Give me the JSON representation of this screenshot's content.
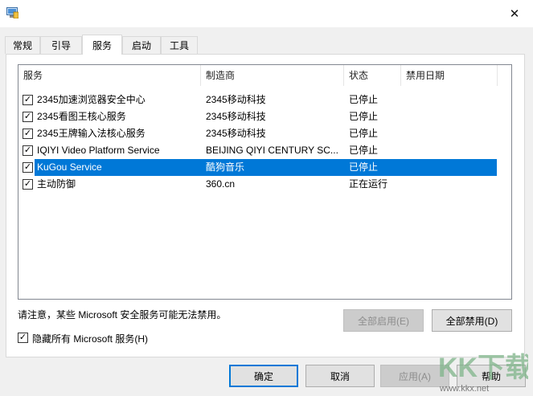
{
  "window": {
    "close_icon": "✕"
  },
  "tabs": [
    {
      "label": "常规",
      "active": false
    },
    {
      "label": "引导",
      "active": false
    },
    {
      "label": "服务",
      "active": true
    },
    {
      "label": "启动",
      "active": false
    },
    {
      "label": "工具",
      "active": false
    }
  ],
  "table": {
    "columns": [
      "服务",
      "制造商",
      "状态",
      "禁用日期"
    ],
    "rows": [
      {
        "checked": true,
        "service": "2345加速浏览器安全中心",
        "manufacturer": "2345移动科技",
        "status": "已停止",
        "date": "",
        "selected": false
      },
      {
        "checked": true,
        "service": "2345看图王核心服务",
        "manufacturer": "2345移动科技",
        "status": "已停止",
        "date": "",
        "selected": false
      },
      {
        "checked": true,
        "service": "2345王牌输入法核心服务",
        "manufacturer": "2345移动科技",
        "status": "已停止",
        "date": "",
        "selected": false
      },
      {
        "checked": true,
        "service": "IQIYI Video Platform Service",
        "manufacturer": "BEIJING QIYI CENTURY SC...",
        "status": "已停止",
        "date": "",
        "selected": false
      },
      {
        "checked": true,
        "service": "KuGou Service",
        "manufacturer": "酷狗音乐",
        "status": "已停止",
        "date": "",
        "selected": true
      },
      {
        "checked": true,
        "service": "主动防御",
        "manufacturer": "360.cn",
        "status": "正在运行",
        "date": "",
        "selected": false
      }
    ]
  },
  "note": "请注意，某些 Microsoft 安全服务可能无法禁用。",
  "buttons": {
    "enable_all": "全部启用(E)",
    "disable_all": "全部禁用(D)",
    "ok": "确定",
    "cancel": "取消",
    "apply": "应用(A)",
    "help": "帮助"
  },
  "hide_ms": {
    "label": "隐藏所有 Microsoft 服务(H)",
    "checked": true
  },
  "watermark": {
    "text": "KK下载",
    "url": "www.kkx.net"
  },
  "colors": {
    "selection": "#0078d7",
    "watermark": "#7fb48a"
  },
  "icons": {
    "checkbox_checked": "✓"
  }
}
